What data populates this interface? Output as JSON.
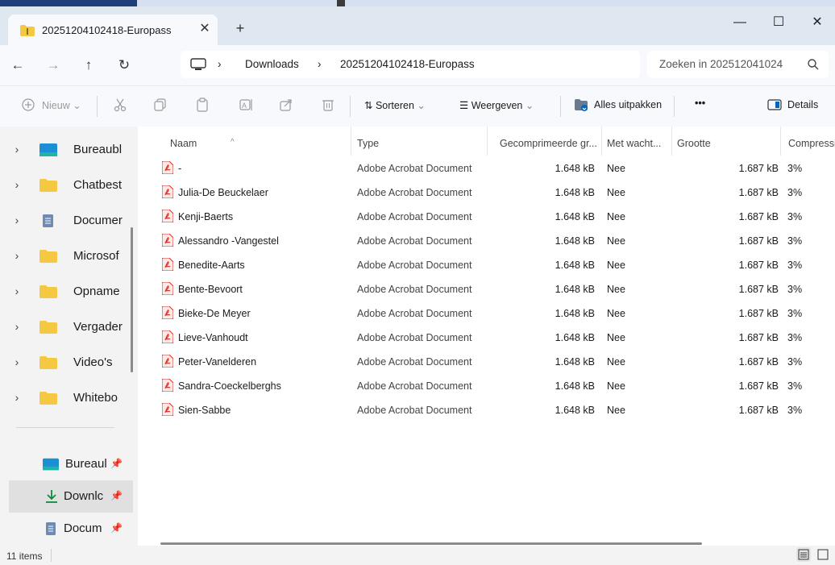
{
  "window": {
    "tab_title": "20251204102418-Europass",
    "new_tab_label": "+",
    "close_tab_label": "✕",
    "minimize": "—",
    "maximize": "☐",
    "close": "✕"
  },
  "nav": {
    "back": "←",
    "forward": "→",
    "up": "↑",
    "refresh": "↻",
    "crumbs": [
      "Downloads",
      "20251204102418-Europass"
    ],
    "crumb_sep": "›",
    "search_placeholder": "Zoeken in 202512041024"
  },
  "commands": {
    "new": "Nieuw",
    "sort": "Sorteren",
    "view": "Weergeven",
    "extract_all": "Alles uitpakken",
    "more": "•••",
    "details": "Details"
  },
  "sidebar": {
    "tree": [
      {
        "label": "Bureaubl",
        "icon": "desktop-icon"
      },
      {
        "label": "Chatbest",
        "icon": "folder-icon"
      },
      {
        "label": "Documer",
        "icon": "documents-icon"
      },
      {
        "label": "Microsof",
        "icon": "folder-icon"
      },
      {
        "label": "Opname",
        "icon": "folder-icon"
      },
      {
        "label": "Vergader",
        "icon": "folder-icon"
      },
      {
        "label": "Video's",
        "icon": "folder-icon"
      },
      {
        "label": "Whitebo",
        "icon": "folder-icon"
      }
    ],
    "quick_access": [
      {
        "label": "Bureaul",
        "icon": "desktop-icon"
      },
      {
        "label": "Downlc",
        "icon": "download-icon",
        "selected": true
      },
      {
        "label": "Docum",
        "icon": "documents-icon"
      }
    ]
  },
  "columns": {
    "name": "Naam",
    "type": "Type",
    "compressed": "Gecomprimeerde gr...",
    "password": "Met wacht...",
    "size": "Grootte",
    "ratio": "Compressi"
  },
  "files": [
    {
      "name": "-",
      "type": "Adobe Acrobat Document",
      "compressed": "1.648 kB",
      "password": "Nee",
      "size": "1.687 kB",
      "ratio": "3%"
    },
    {
      "name": "Julia-De Beuckelaer",
      "type": "Adobe Acrobat Document",
      "compressed": "1.648 kB",
      "password": "Nee",
      "size": "1.687 kB",
      "ratio": "3%"
    },
    {
      "name": "Kenji-Baerts",
      "type": "Adobe Acrobat Document",
      "compressed": "1.648 kB",
      "password": "Nee",
      "size": "1.687 kB",
      "ratio": "3%"
    },
    {
      "name": "Alessandro -Vangestel",
      "type": "Adobe Acrobat Document",
      "compressed": "1.648 kB",
      "password": "Nee",
      "size": "1.687 kB",
      "ratio": "3%"
    },
    {
      "name": "Benedite-Aarts",
      "type": "Adobe Acrobat Document",
      "compressed": "1.648 kB",
      "password": "Nee",
      "size": "1.687 kB",
      "ratio": "3%"
    },
    {
      "name": "Bente-Bevoort",
      "type": "Adobe Acrobat Document",
      "compressed": "1.648 kB",
      "password": "Nee",
      "size": "1.687 kB",
      "ratio": "3%"
    },
    {
      "name": "Bieke-De Meyer",
      "type": "Adobe Acrobat Document",
      "compressed": "1.648 kB",
      "password": "Nee",
      "size": "1.687 kB",
      "ratio": "3%"
    },
    {
      "name": "Lieve-Vanhoudt",
      "type": "Adobe Acrobat Document",
      "compressed": "1.648 kB",
      "password": "Nee",
      "size": "1.687 kB",
      "ratio": "3%"
    },
    {
      "name": "Peter-Vanelderen",
      "type": "Adobe Acrobat Document",
      "compressed": "1.648 kB",
      "password": "Nee",
      "size": "1.687 kB",
      "ratio": "3%"
    },
    {
      "name": "Sandra-Coeckelberghs",
      "type": "Adobe Acrobat Document",
      "compressed": "1.648 kB",
      "password": "Nee",
      "size": "1.687 kB",
      "ratio": "3%"
    },
    {
      "name": "Sien-Sabbe",
      "type": "Adobe Acrobat Document",
      "compressed": "1.648 kB",
      "password": "Nee",
      "size": "1.687 kB",
      "ratio": "3%"
    }
  ],
  "status": {
    "item_count": "11 items"
  },
  "colors": {
    "folder": "#f5c842",
    "pdf": "#d9342b",
    "accent": "#0067c0"
  }
}
